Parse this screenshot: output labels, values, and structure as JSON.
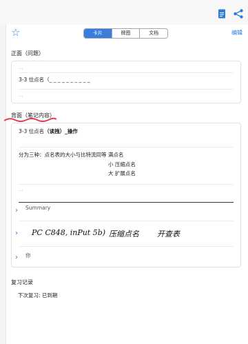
{
  "toolbar": {
    "doc_icon": "document-icon",
    "share_icon": "share-icon"
  },
  "header": {
    "star_icon": "star-icon",
    "tabs": [
      "卡片",
      "牌图",
      "文档"
    ],
    "active_tab": 0,
    "edit_label": "编辑"
  },
  "front": {
    "title": "正面（问题）",
    "placeholder_top": "...",
    "question": "3-3 位点名（_ _ _ _ _ _ _ _ _ _",
    "placeholder_bottom": "..."
  },
  "back": {
    "title": "背面（笔记内容）",
    "heading_normal": "3-3 位点名",
    "heading_bold": "（读拽）_操作",
    "note_line1": "分为三种：点名表的大小与比特流同等  满点名",
    "note_line2": "小  压缩点名",
    "note_line3": "大  扩展点名",
    "placeholder": "...",
    "summary_label": "Summary",
    "handwriting": [
      "PC C848, inPut 5b)",
      "压缩点名",
      "开查表"
    ],
    "you_label": "你"
  },
  "review": {
    "title": "复习记录",
    "next_label": "下次复习: 已到期"
  },
  "colors": {
    "accent": "#2f7bd6",
    "highlight": "#e8394a"
  }
}
